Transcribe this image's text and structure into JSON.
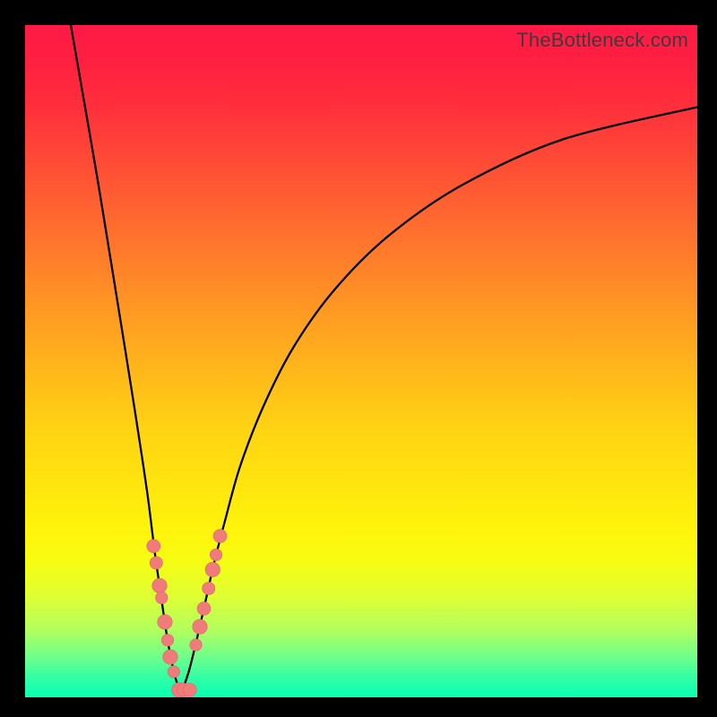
{
  "watermark": "TheBottleneck.com",
  "colors": {
    "frame": "#000000",
    "curve": "#000000",
    "marker_fill": "#ef7b7a",
    "marker_stroke": "#d96a69"
  },
  "chart_data": {
    "type": "line",
    "title": "",
    "xlabel": "",
    "ylabel": "",
    "xlim": [
      0,
      100
    ],
    "ylim": [
      0,
      100
    ],
    "note": "No axes or ticks are rendered; values are relative coordinates within the gradient plot area (0,0 = top-left, 100,100 = bottom-right). Two V-shaped black curves meeting near the bottom. Markers cluster along the curves near the tip.",
    "series": [
      {
        "name": "left-arm",
        "type": "line",
        "points": [
          {
            "x": 6.8,
            "y": 0.0
          },
          {
            "x": 8.8,
            "y": 11.5
          },
          {
            "x": 10.7,
            "y": 22.5
          },
          {
            "x": 12.5,
            "y": 33.5
          },
          {
            "x": 14.2,
            "y": 44.0
          },
          {
            "x": 15.8,
            "y": 54.0
          },
          {
            "x": 17.2,
            "y": 63.0
          },
          {
            "x": 18.3,
            "y": 70.5
          },
          {
            "x": 19.3,
            "y": 78.5
          },
          {
            "x": 20.3,
            "y": 85.5
          },
          {
            "x": 21.2,
            "y": 91.5
          },
          {
            "x": 22.2,
            "y": 96.5
          },
          {
            "x": 23.0,
            "y": 99.0
          }
        ]
      },
      {
        "name": "right-arm",
        "type": "line",
        "points": [
          {
            "x": 23.4,
            "y": 99.0
          },
          {
            "x": 24.4,
            "y": 96.0
          },
          {
            "x": 25.4,
            "y": 92.0
          },
          {
            "x": 26.6,
            "y": 86.8
          },
          {
            "x": 28.0,
            "y": 80.5
          },
          {
            "x": 29.8,
            "y": 73.5
          },
          {
            "x": 32.0,
            "y": 65.6
          },
          {
            "x": 35.5,
            "y": 56.6
          },
          {
            "x": 40.0,
            "y": 47.8
          },
          {
            "x": 46.0,
            "y": 39.4
          },
          {
            "x": 54.0,
            "y": 31.4
          },
          {
            "x": 65.0,
            "y": 23.8
          },
          {
            "x": 80.0,
            "y": 17.0
          },
          {
            "x": 100.0,
            "y": 12.2
          }
        ]
      }
    ],
    "markers": [
      {
        "x": 19.1,
        "y": 77.5,
        "r": 1.0
      },
      {
        "x": 19.5,
        "y": 80.0,
        "r": 0.95
      },
      {
        "x": 20.0,
        "y": 83.4,
        "r": 1.1
      },
      {
        "x": 20.3,
        "y": 85.2,
        "r": 0.9
      },
      {
        "x": 20.8,
        "y": 88.8,
        "r": 1.1
      },
      {
        "x": 21.2,
        "y": 91.5,
        "r": 0.9
      },
      {
        "x": 21.6,
        "y": 94.0,
        "r": 1.1
      },
      {
        "x": 22.1,
        "y": 96.2,
        "r": 0.9
      },
      {
        "x": 22.9,
        "y": 98.9,
        "r": 1.1
      },
      {
        "x": 23.6,
        "y": 98.9,
        "r": 1.0
      },
      {
        "x": 24.5,
        "y": 98.9,
        "r": 1.0
      },
      {
        "x": 25.4,
        "y": 92.2,
        "r": 0.9
      },
      {
        "x": 26.0,
        "y": 89.5,
        "r": 1.1
      },
      {
        "x": 26.6,
        "y": 86.8,
        "r": 1.0
      },
      {
        "x": 27.3,
        "y": 83.8,
        "r": 0.95
      },
      {
        "x": 27.9,
        "y": 81.0,
        "r": 1.1
      },
      {
        "x": 28.4,
        "y": 78.8,
        "r": 0.9
      },
      {
        "x": 29.0,
        "y": 76.0,
        "r": 1.0
      }
    ]
  }
}
